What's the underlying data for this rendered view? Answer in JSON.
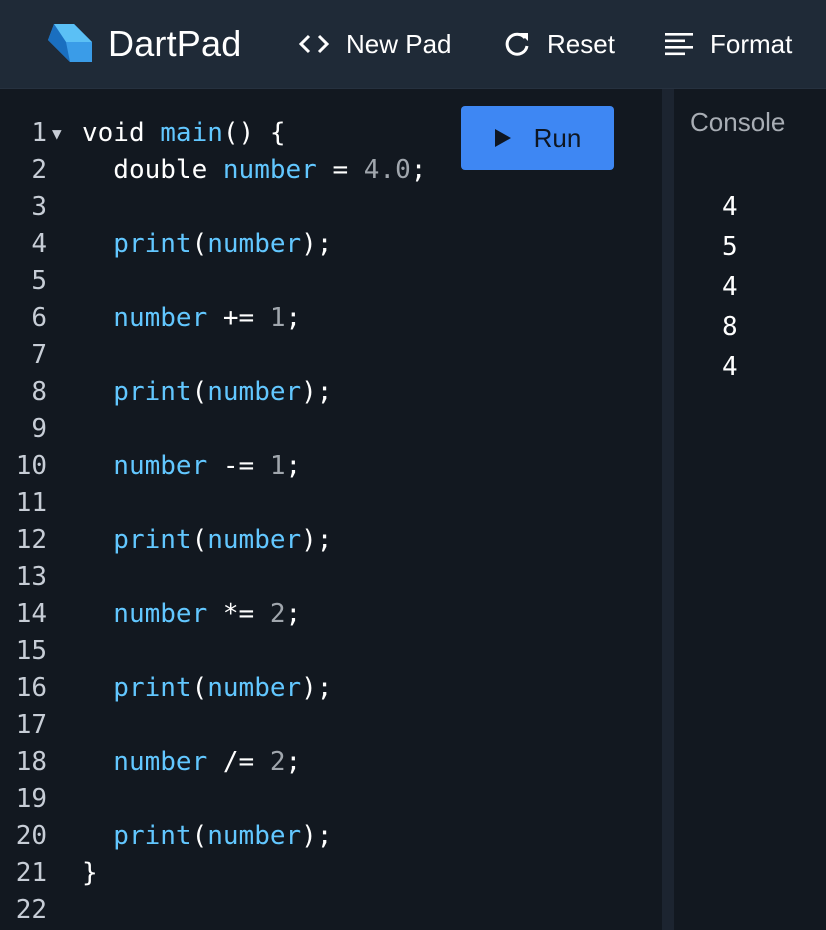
{
  "header": {
    "app_name": "DartPad",
    "new_pad_label": "New Pad",
    "reset_label": "Reset",
    "format_label": "Format",
    "icons": {
      "logo": "dart-logo",
      "new_pad": "code-brackets-icon",
      "reset": "refresh-icon",
      "format": "format-lines-icon"
    }
  },
  "editor": {
    "run_label": "Run",
    "lines": [
      {
        "n": "1",
        "tokens": [
          {
            "t": "void ",
            "c": "kw"
          },
          {
            "t": "main",
            "c": "fn"
          },
          {
            "t": "() {",
            "c": "op"
          }
        ]
      },
      {
        "n": "2",
        "tokens": [
          {
            "t": "  double ",
            "c": "kw"
          },
          {
            "t": "number",
            "c": "fn"
          },
          {
            "t": " = ",
            "c": "op"
          },
          {
            "t": "4.0",
            "c": "num"
          },
          {
            "t": ";",
            "c": "op"
          }
        ]
      },
      {
        "n": "3",
        "tokens": []
      },
      {
        "n": "4",
        "tokens": [
          {
            "t": "  print",
            "c": "fn"
          },
          {
            "t": "(",
            "c": "op"
          },
          {
            "t": "number",
            "c": "fn"
          },
          {
            "t": ");",
            "c": "op"
          }
        ]
      },
      {
        "n": "5",
        "tokens": []
      },
      {
        "n": "6",
        "tokens": [
          {
            "t": "  number",
            "c": "fn"
          },
          {
            "t": " += ",
            "c": "op"
          },
          {
            "t": "1",
            "c": "num"
          },
          {
            "t": ";",
            "c": "op"
          }
        ]
      },
      {
        "n": "7",
        "tokens": []
      },
      {
        "n": "8",
        "tokens": [
          {
            "t": "  print",
            "c": "fn"
          },
          {
            "t": "(",
            "c": "op"
          },
          {
            "t": "number",
            "c": "fn"
          },
          {
            "t": ");",
            "c": "op"
          }
        ]
      },
      {
        "n": "9",
        "tokens": []
      },
      {
        "n": "10",
        "tokens": [
          {
            "t": "  number",
            "c": "fn"
          },
          {
            "t": " -= ",
            "c": "op"
          },
          {
            "t": "1",
            "c": "num"
          },
          {
            "t": ";",
            "c": "op"
          }
        ]
      },
      {
        "n": "11",
        "tokens": []
      },
      {
        "n": "12",
        "tokens": [
          {
            "t": "  print",
            "c": "fn"
          },
          {
            "t": "(",
            "c": "op"
          },
          {
            "t": "number",
            "c": "fn"
          },
          {
            "t": ");",
            "c": "op"
          }
        ]
      },
      {
        "n": "13",
        "tokens": []
      },
      {
        "n": "14",
        "tokens": [
          {
            "t": "  number",
            "c": "fn"
          },
          {
            "t": " *= ",
            "c": "op"
          },
          {
            "t": "2",
            "c": "num"
          },
          {
            "t": ";",
            "c": "op"
          }
        ]
      },
      {
        "n": "15",
        "tokens": []
      },
      {
        "n": "16",
        "tokens": [
          {
            "t": "  print",
            "c": "fn"
          },
          {
            "t": "(",
            "c": "op"
          },
          {
            "t": "number",
            "c": "fn"
          },
          {
            "t": ");",
            "c": "op"
          }
        ]
      },
      {
        "n": "17",
        "tokens": []
      },
      {
        "n": "18",
        "tokens": [
          {
            "t": "  number",
            "c": "fn"
          },
          {
            "t": " /= ",
            "c": "op"
          },
          {
            "t": "2",
            "c": "num"
          },
          {
            "t": ";",
            "c": "op"
          }
        ]
      },
      {
        "n": "19",
        "tokens": []
      },
      {
        "n": "20",
        "tokens": [
          {
            "t": "  print",
            "c": "fn"
          },
          {
            "t": "(",
            "c": "op"
          },
          {
            "t": "number",
            "c": "fn"
          },
          {
            "t": ");",
            "c": "op"
          }
        ]
      },
      {
        "n": "21",
        "tokens": [
          {
            "t": "}",
            "c": "op"
          }
        ]
      },
      {
        "n": "22",
        "tokens": []
      }
    ]
  },
  "console": {
    "title": "Console",
    "output": [
      "4",
      "5",
      "4",
      "8",
      "4"
    ]
  },
  "colors": {
    "accent": "#3e87f3",
    "identifier": "#62c7ff",
    "number_literal": "#a0a6ad",
    "background": "#121820",
    "header": "#1f2a37"
  }
}
